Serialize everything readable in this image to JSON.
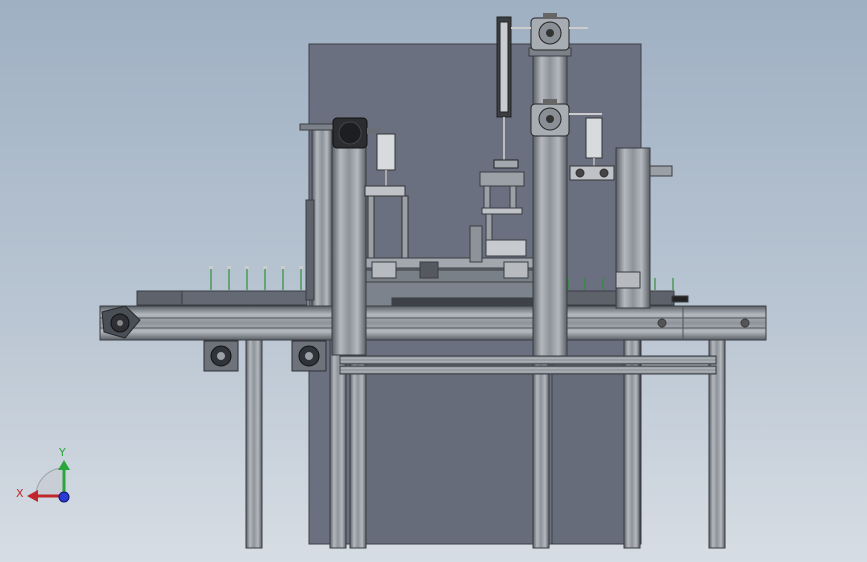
{
  "drawing": {
    "description_free": true,
    "colors": {
      "background_top": "#9fb0c3",
      "background_bottom": "#d7dde4",
      "panel": "#6b7080",
      "profile": "#9aa0a6",
      "profile_dark": "#4a4e55",
      "motor": "#2b2d31",
      "axis_x": "#c0272d",
      "axis_y": "#2aa63a",
      "axis_z": "#2a3bd1"
    }
  },
  "triad": {
    "x_label": "X",
    "y_label": "Y",
    "icons": [
      "axis-x-arrow-icon",
      "axis-y-arrow-icon",
      "axis-z-dot-icon"
    ]
  }
}
